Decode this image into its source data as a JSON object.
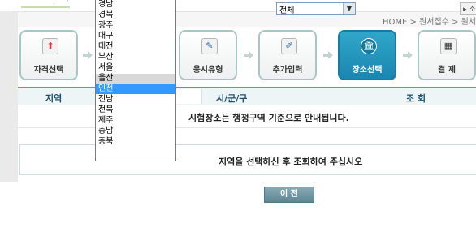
{
  "header": {
    "breadcrumb": "HOME > 원서접수 > 원서"
  },
  "steps": [
    {
      "label": "자격선택",
      "icon": "arrow-up-icon",
      "glyph": "⬆"
    },
    {
      "label": "",
      "icon": "step-icon",
      "glyph": ""
    },
    {
      "label": "응시유형",
      "icon": "edit-document-icon",
      "glyph": "✎"
    },
    {
      "label": "추가입력",
      "icon": "write-icon",
      "glyph": "✐"
    },
    {
      "label": "장소선택",
      "icon": "building-icon",
      "glyph": "🏛"
    },
    {
      "label": "결  제",
      "icon": "calculator-icon",
      "glyph": "▦"
    }
  ],
  "filter": {
    "region_label": "지역",
    "city_label": "시/군/구",
    "city_select_value": "전체",
    "search_label": "조  회",
    "search_button_label": "조"
  },
  "notice": "시험장소는 행정구역 기준으로 안내됩니다.",
  "message": "지역을 선택하신 후 조회하여 주십시오",
  "prev_button": "이  전",
  "dropdown": {
    "items": [
      "경남",
      "경북",
      "광주",
      "대구",
      "대전",
      "부산",
      "서울",
      "울산",
      "인천",
      "전남",
      "전북",
      "제주",
      "충남",
      "충북"
    ],
    "hover_index": 7,
    "selected_index": 8
  },
  "colors": {
    "accent": "#1b86b1",
    "selected": "#3399ff",
    "header_line": "#4b9fb8"
  }
}
